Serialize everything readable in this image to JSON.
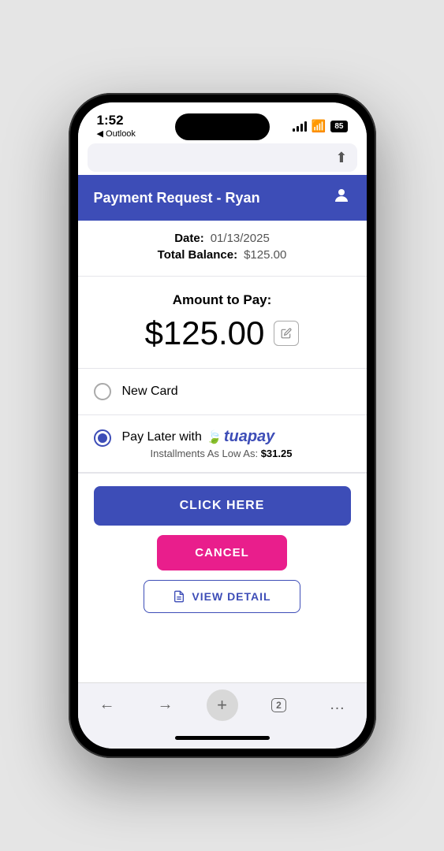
{
  "status": {
    "time": "1:52",
    "back_label": "◀ Outlook",
    "battery": "85"
  },
  "header": {
    "title": "Payment Request - Ryan"
  },
  "info": {
    "date_label": "Date:",
    "date_value": "01/13/2025",
    "balance_label": "Total Balance:",
    "balance_value": "$125.00"
  },
  "amount": {
    "label": "Amount to Pay:",
    "value": "$125.00"
  },
  "payment_options": [
    {
      "id": "new_card",
      "label": "New Card",
      "selected": false
    },
    {
      "id": "tua_pay",
      "label": "Pay Later with",
      "brand": "tuapay",
      "installments_prefix": "Installments As Low As: ",
      "installments_amount": "$31.25",
      "selected": true
    }
  ],
  "buttons": {
    "click_here": "CLICK HERE",
    "cancel": "CANCEL",
    "view_detail": "VIEW DETAIL"
  },
  "bottom_nav": {
    "tab_count": "2"
  }
}
